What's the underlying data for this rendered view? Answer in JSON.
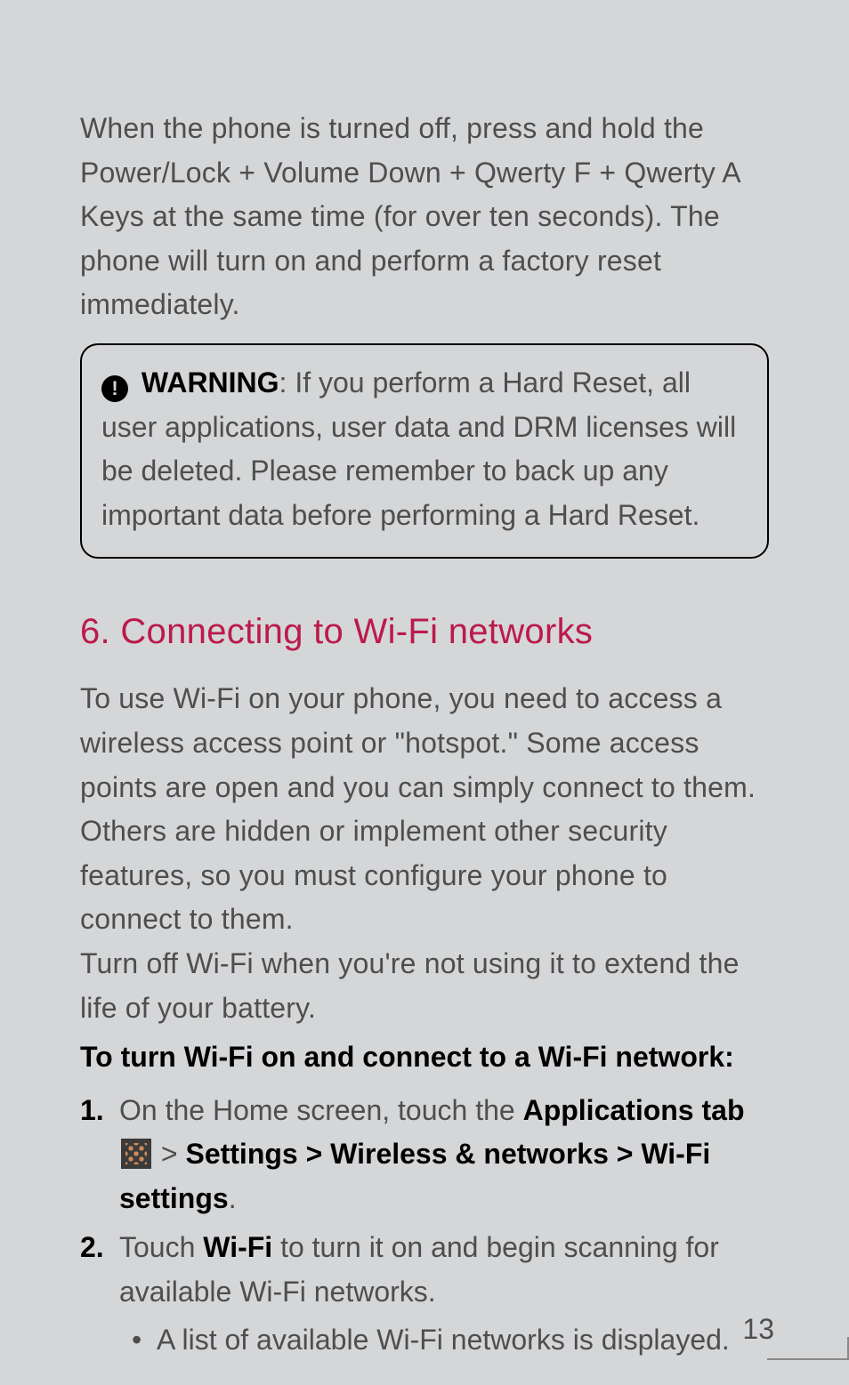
{
  "intro_para": "When the phone is turned off, press and hold the Power/Lock + Volume Down + Qwerty F + Qwerty A Keys at the same time (for over ten seconds). The phone will turn on and perform a factory reset immediately.",
  "warning": {
    "label": "WARNING",
    "text": ": If you perform a Hard Reset, all user applications, user data and DRM licenses will be deleted. Please remember to back up any important data before performing a Hard Reset."
  },
  "section_heading": "6. Connecting to Wi-Fi networks",
  "section_para1": "To use Wi-Fi on your phone, you need to access a wireless access point or \"hotspot.\" Some access points are open and you can simply connect to them. Others are hidden or implement other security features, so you must configure your phone to connect to them.",
  "section_para2": "Turn off Wi-Fi when you're not using it to extend the life of your battery.",
  "sub_heading": "To turn Wi-Fi on and connect to a Wi-Fi network:",
  "steps": [
    {
      "num": "1.",
      "pre": "On the Home screen, touch the ",
      "bold1": "Applications tab",
      "mid": " ",
      "after_icon": " > ",
      "bold2": "Settings > Wireless & networks > Wi-Fi settings",
      "post": "."
    },
    {
      "num": "2.",
      "pre": "Touch ",
      "bold1": "Wi-Fi",
      "mid": " to turn it on and begin scanning for available Wi-Fi networks.",
      "bullet": "A list of available Wi-Fi networks is displayed."
    }
  ],
  "page_number": "13"
}
